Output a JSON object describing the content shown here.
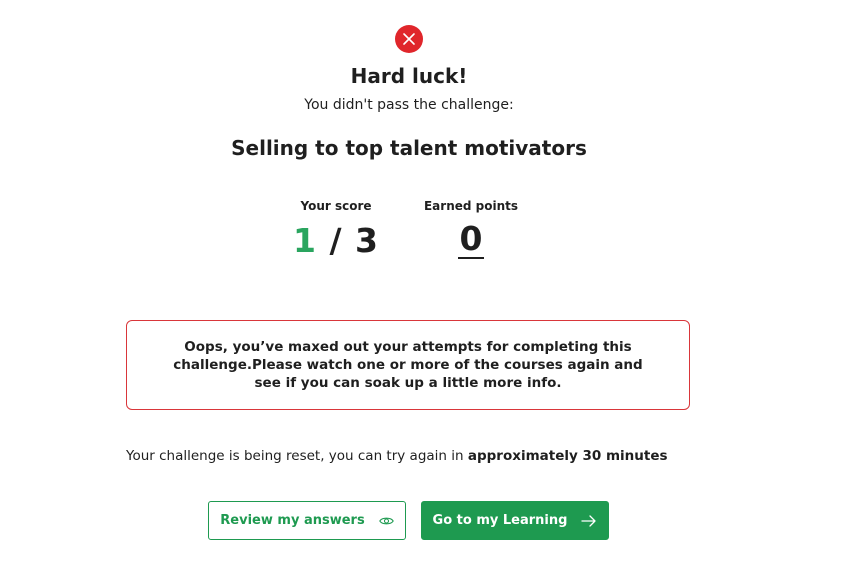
{
  "result": {
    "status_icon": "close-circle-icon",
    "status_color": "#e0262b",
    "title": "Hard luck!",
    "subtitle": "You didn't pass the challenge:",
    "challenge_name": "Selling to top talent motivators"
  },
  "stats": {
    "score_label": "Your score",
    "score_correct": "1",
    "score_separator": "/",
    "score_total": "3",
    "points_label": "Earned points",
    "points_value": "0"
  },
  "alert": {
    "message": "Oops, you’ve maxed out your attempts for completing this challenge.Please watch one or more of the courses again and see if you can soak up a little more info.",
    "border_color": "#d9363a"
  },
  "reset": {
    "text": "Your challenge is being reset, you can try again in",
    "time_text": "approximately 30 minutes"
  },
  "actions": {
    "review_label": "Review my answers",
    "review_icon": "eye-icon",
    "learning_label": "Go to my Learning",
    "learning_icon": "arrow-right-icon",
    "accent_color": "#1e9a50",
    "score_color": "#2aa55f"
  }
}
